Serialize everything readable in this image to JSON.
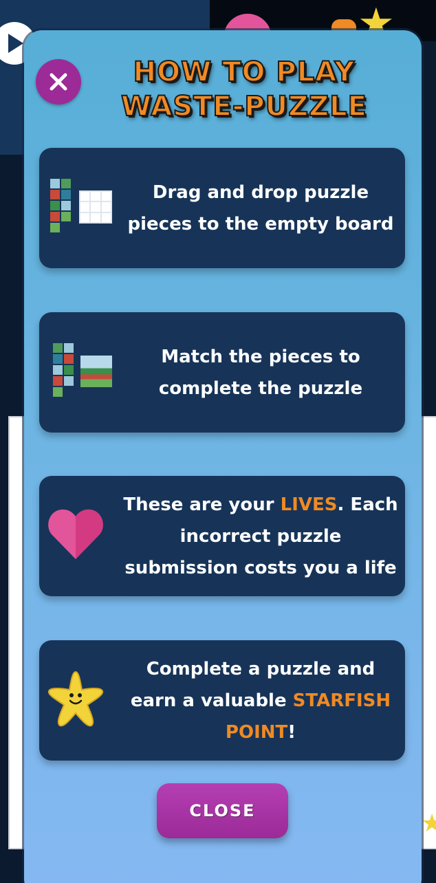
{
  "modal": {
    "title": "How to play Waste-Puzzle",
    "close_label": "Close"
  },
  "steps": [
    {
      "icon": "puzzle-pieces-board-icon",
      "text": "Drag and drop puzzle pieces to the empty board"
    },
    {
      "icon": "puzzle-complete-icon",
      "text": "Match the pieces to complete the puzzle"
    },
    {
      "icon": "heart-icon",
      "pre": "These are your ",
      "highlight": "Lives",
      "post": ". Each incorrect puzzle submission costs you a life"
    },
    {
      "icon": "starfish-icon",
      "pre": "Complete a puzzle and earn a valuable ",
      "highlight": "Starfish Point",
      "post": "!"
    }
  ],
  "colors": {
    "modal_bg_top": "#56aed6",
    "modal_bg_bottom": "#86b8f2",
    "card_bg": "#173458",
    "accent_orange": "#f08a24",
    "accent_purple": "#9c2a97",
    "heart_pink": "#e2559a",
    "starfish_yellow": "#f2d33a"
  }
}
